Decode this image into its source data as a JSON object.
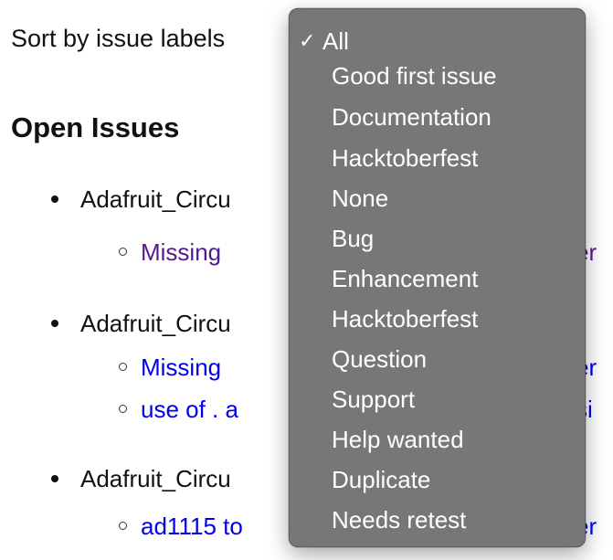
{
  "sort": {
    "label": "Sort by issue labels"
  },
  "heading": "Open Issues",
  "repos": [
    {
      "name": "Adafruit_Circu",
      "issues": [
        {
          "text": "Missing",
          "tail": "er",
          "visited": true
        }
      ]
    },
    {
      "name": "Adafruit_Circu",
      "issues": [
        {
          "text": "Missing",
          "tail": "er",
          "visited": false
        },
        {
          "text": "use of . a",
          "tail": "si",
          "visited": false
        }
      ]
    },
    {
      "name": "Adafruit_Circu",
      "issues": [
        {
          "text": "ad1115 to",
          "tail": "er",
          "visited": false
        }
      ]
    }
  ],
  "dropdown": {
    "check_glyph": "✓",
    "selected_index": 0,
    "options": [
      "All",
      "Good first issue",
      "Documentation",
      "Hacktoberfest",
      "None",
      "Bug",
      "Enhancement",
      "Hacktoberfest",
      "Question",
      "Support",
      "Help wanted",
      "Duplicate",
      "Needs retest"
    ]
  },
  "colors": {
    "link": "#0000ee",
    "visited_link": "#551a8b",
    "menu_background": "#777779",
    "menu_text": "#ffffff"
  }
}
